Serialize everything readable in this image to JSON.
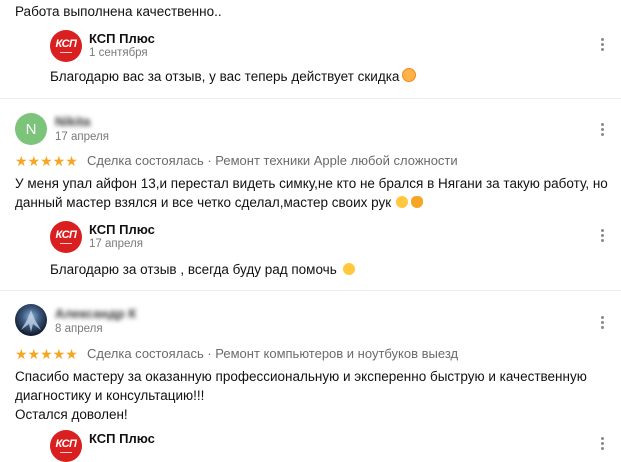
{
  "reviews": [
    {
      "text_tail": "Работа выполнена качественно..",
      "reply": {
        "name": "КСП Плюс",
        "date": "1 сентября",
        "text": "Благодарю вас за отзыв, у вас теперь действует скидка"
      }
    },
    {
      "avatar_letter": "N",
      "author": "Nikita",
      "date": "17 апреля",
      "rating": 5,
      "stars": "★★★★★",
      "meta": "Сделка состоялась · Ремонт техники Apple любой сложности",
      "text_line1": "У меня упал айфон 13,и перестал видеть симку,не кто не брался в Нягани за такую работу, но",
      "text_line2": "данный мастер взялся и все четко сделал,мастер своих рук",
      "reply": {
        "name": "КСП Плюс",
        "date": "17 апреля",
        "text": "Благодарю за отзыв , всегда буду рад помочь"
      }
    },
    {
      "author": "Александр К",
      "date": "8 апреля",
      "rating": 5,
      "stars": "★★★★★",
      "meta": "Сделка состоялась · Ремонт компьютеров и ноутбуков выезд",
      "text_line1": "Спасибо мастеру за оказанную профессиональную и эксперенно быструю и качественную",
      "text_line2": "диагностику и консультацию!!!",
      "text_line3": "Остался доволен!",
      "reply": {
        "name": "КСП Плюс"
      }
    }
  ],
  "logo_text": "КСП",
  "icons": {
    "more": "more-vertical-icon",
    "star": "star-icon",
    "logo": "ksp-logo"
  },
  "colors": {
    "star": "#f5a623",
    "logo": "#d91f1f",
    "avatar_n": "#7cc47a"
  }
}
